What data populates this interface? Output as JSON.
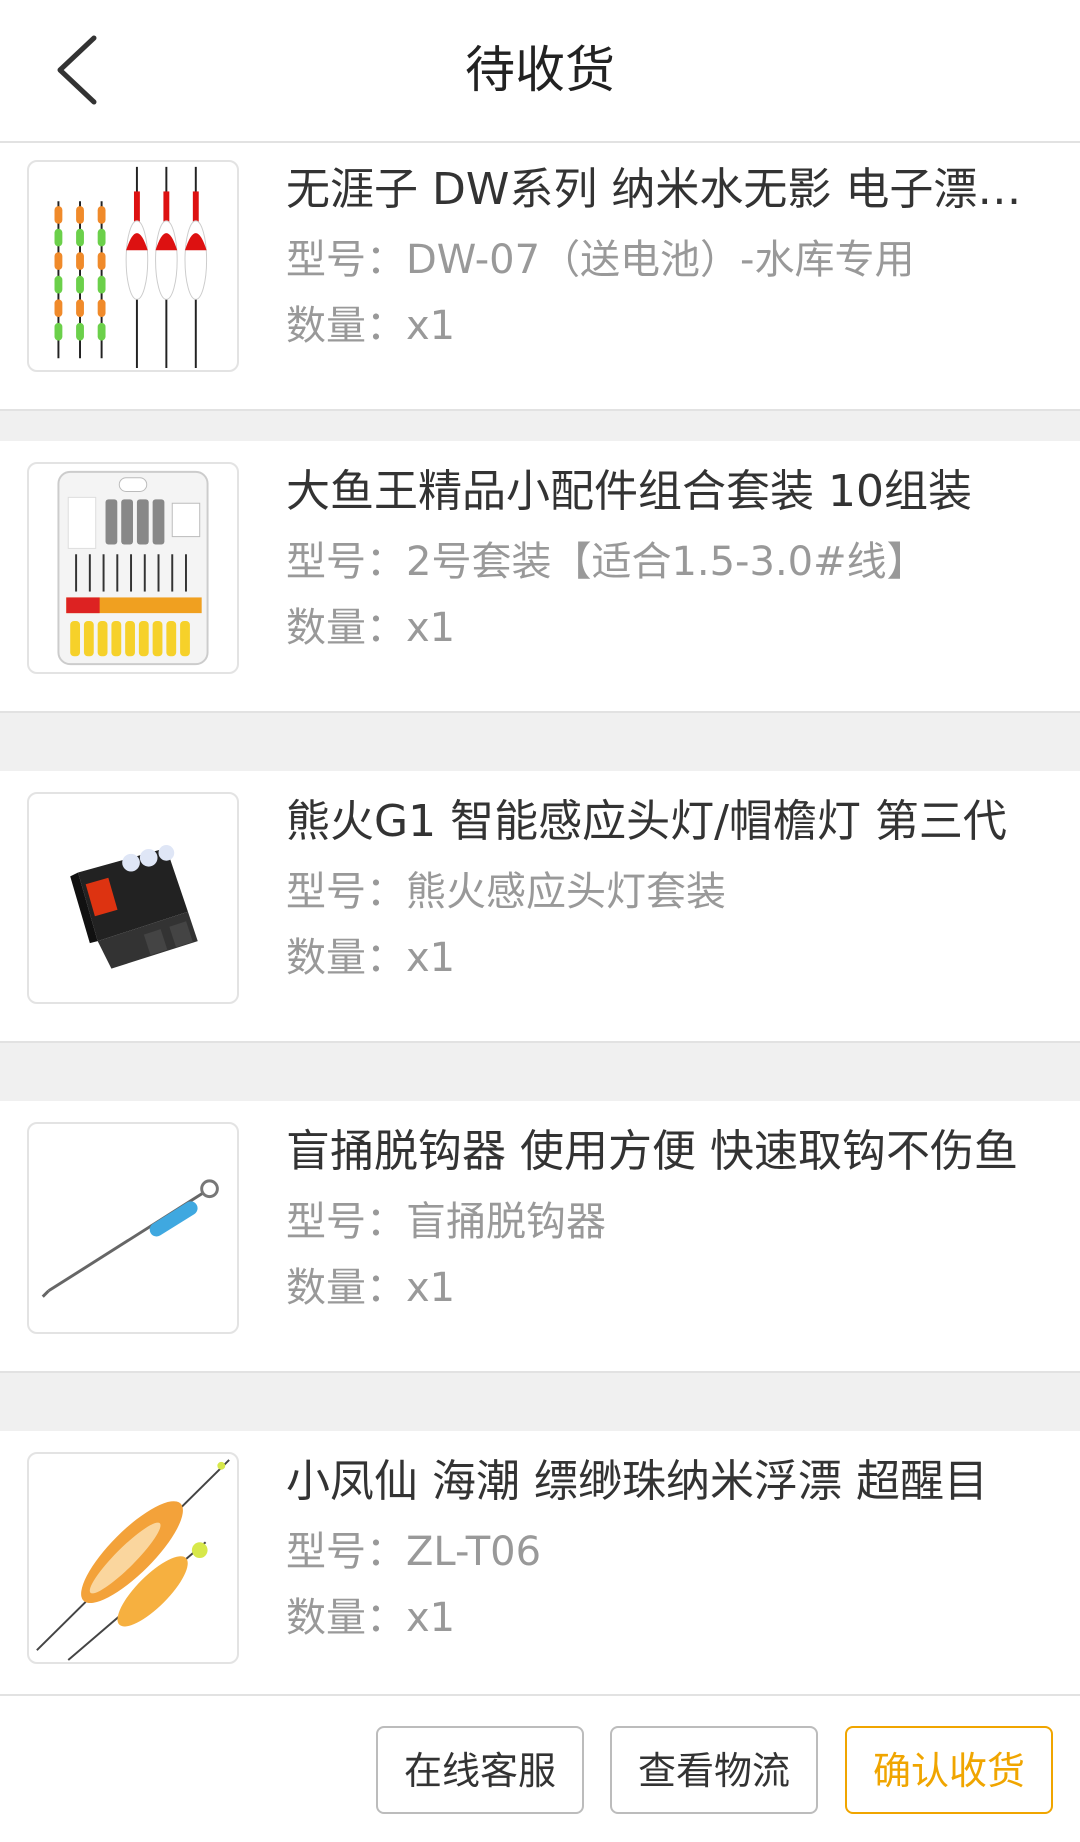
{
  "header": {
    "title": "待收货"
  },
  "orders": [
    {
      "title": "无涯子 DW系列 纳米水无影 电子漂夜光漂",
      "spec_label": "型号：",
      "spec_value": "DW-07（送电池）-水库专用",
      "qty_label": "数量：",
      "qty_value": "x1",
      "image_icon": "fishing-float-set-icon"
    },
    {
      "title": "大鱼王精品小配件组合套装 10组装",
      "spec_label": "型号：",
      "spec_value": "2号套装【适合1.5-3.0#线】",
      "qty_label": "数量：",
      "qty_value": "x1",
      "image_icon": "accessory-kit-icon"
    },
    {
      "title": "熊火G1 智能感应头灯/帽檐灯 第三代",
      "spec_label": "型号：",
      "spec_value": "熊火感应头灯套装",
      "qty_label": "数量：",
      "qty_value": "x1",
      "image_icon": "headlamp-icon"
    },
    {
      "title": "盲捅脱钩器 使用方便 快速取钩不伤鱼",
      "spec_label": "型号：",
      "spec_value": "盲捅脱钩器",
      "qty_label": "数量：",
      "qty_value": "x1",
      "image_icon": "hook-remover-icon"
    },
    {
      "title": "小凤仙 海潮 缥缈珠纳米浮漂 超醒目",
      "spec_label": "型号：",
      "spec_value": "ZL-T06",
      "qty_label": "数量：",
      "qty_value": "x1",
      "image_icon": "nano-float-icon"
    }
  ],
  "footer": {
    "customer_service": "在线客服",
    "view_logistics": "查看物流",
    "confirm_receipt": "确认收货"
  },
  "colors": {
    "accent": "#f0a500",
    "text": "#333333",
    "muted": "#999999",
    "background": "#f0f0f0"
  }
}
